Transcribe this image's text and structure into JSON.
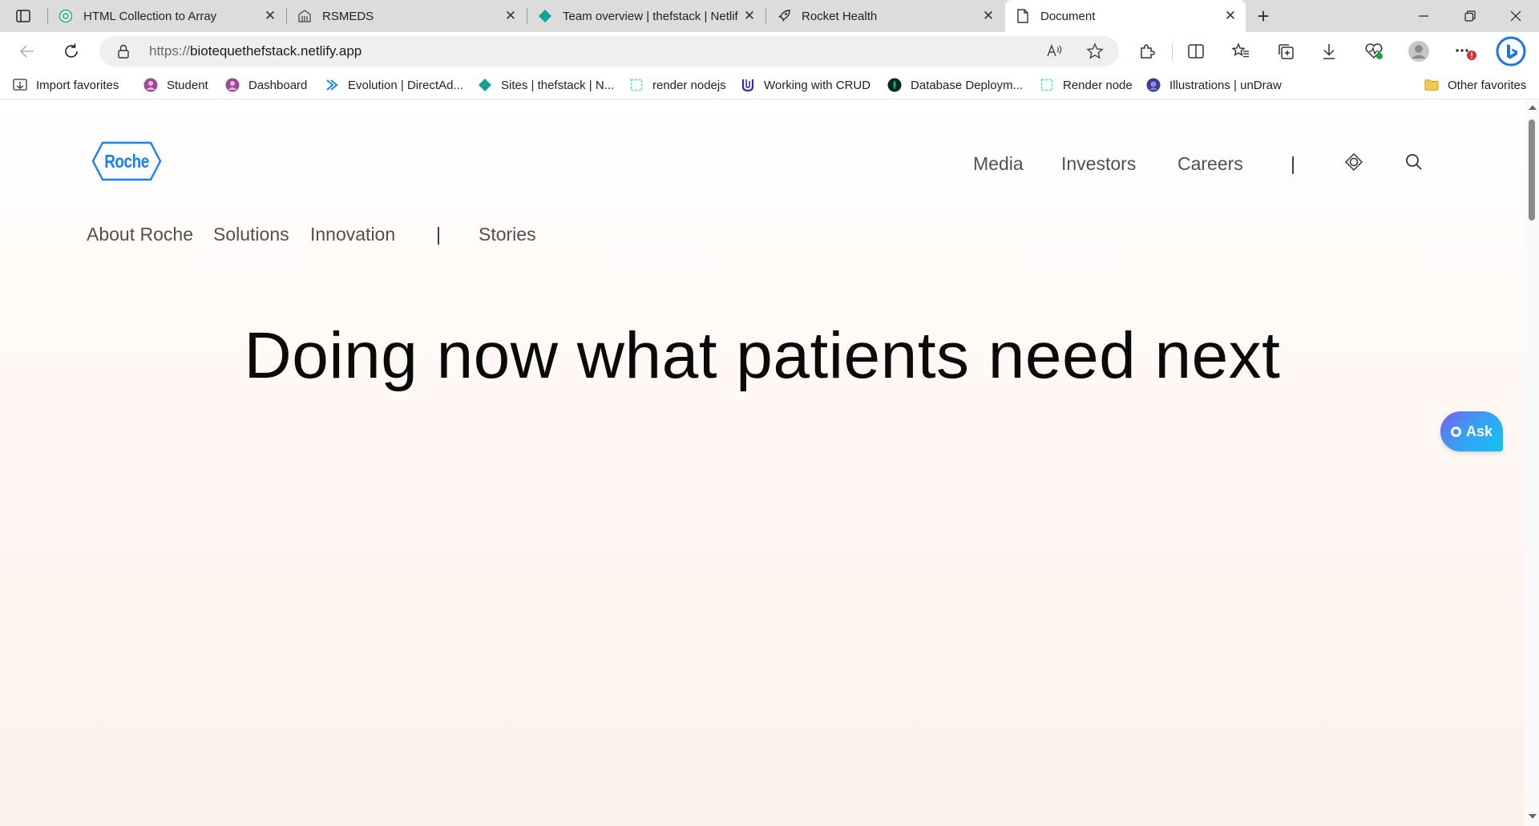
{
  "browser": {
    "tabs": [
      {
        "title": "HTML Collection to Array",
        "icon": "chatgpt-icon",
        "active": false
      },
      {
        "title": "RSMEDS",
        "icon": "building-icon",
        "active": false
      },
      {
        "title": "Team overview | thefstack | Netlif",
        "icon": "netlify-icon",
        "active": false
      },
      {
        "title": "Rocket Health",
        "icon": "rocket-icon",
        "active": false
      },
      {
        "title": "Document",
        "icon": "document-icon",
        "active": true
      }
    ],
    "tab_close_glyph": "✕",
    "new_tab_glyph": "+",
    "address": {
      "protocol": "https://",
      "host": "biotequethefstack.netlify.app"
    },
    "bookmarks": [
      {
        "label": "Import favorites",
        "icon": "import-icon"
      },
      {
        "label": "Student",
        "icon": "student-icon"
      },
      {
        "label": "Dashboard",
        "icon": "dashboard-icon"
      },
      {
        "label": "Evolution | DirectAd...",
        "icon": "evolution-icon"
      },
      {
        "label": "Sites | thefstack | N...",
        "icon": "netlify-icon"
      },
      {
        "label": "render nodejs",
        "icon": "render-icon"
      },
      {
        "label": "Working with CRUD",
        "icon": "udacity-icon"
      },
      {
        "label": "Database Deploym...",
        "icon": "mongodb-icon"
      },
      {
        "label": "Render node",
        "icon": "render-icon"
      },
      {
        "label": "Illustrations | unDraw",
        "icon": "undraw-icon"
      }
    ],
    "other_favorites": "Other favorites",
    "colors": {
      "tabbar": "#dcdcdc",
      "accent": "#0078d4",
      "badge": "#d13438"
    }
  },
  "site": {
    "logo_text": "Roche",
    "logo_color": "#1482fa",
    "top_nav": [
      {
        "label": "Media"
      },
      {
        "label": "Investors"
      },
      {
        "label": "Careers"
      }
    ],
    "top_nav_separator": "|",
    "main_nav": [
      {
        "label": "About Roche"
      },
      {
        "label": "Solutions"
      },
      {
        "label": "Innovation"
      },
      {
        "label": "Stories"
      }
    ],
    "main_nav_separator": "|",
    "hero_title": "Doing now what patients need next",
    "ask_button": "Ask"
  }
}
